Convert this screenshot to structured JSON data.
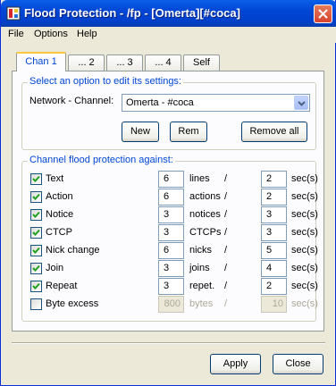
{
  "title": "Flood Protection - /fp - [Omerta][#coca]",
  "menu": [
    "File",
    "Options",
    "Help"
  ],
  "tabs": [
    "Chan 1",
    "... 2",
    "... 3",
    "... 4",
    "Self"
  ],
  "select_group": {
    "label": "Select an option to edit its settings:",
    "network_label": "Network - Channel:",
    "network_value": "Omerta - #coca",
    "new_label": "New",
    "rem_label": "Rem",
    "remove_all_label": "Remove all"
  },
  "flood_group": {
    "label": "Channel flood protection against:",
    "slash": "/",
    "unit": "sec(s)",
    "rows": [
      {
        "name": "Text",
        "checked": true,
        "count": "6",
        "unit": "lines",
        "secs": "2",
        "enabled": true
      },
      {
        "name": "Action",
        "checked": true,
        "count": "6",
        "unit": "actions",
        "secs": "2",
        "enabled": true
      },
      {
        "name": "Notice",
        "checked": true,
        "count": "3",
        "unit": "notices",
        "secs": "3",
        "enabled": true
      },
      {
        "name": "CTCP",
        "checked": true,
        "count": "3",
        "unit": "CTCPs",
        "secs": "3",
        "enabled": true
      },
      {
        "name": "Nick change",
        "checked": true,
        "count": "6",
        "unit": "nicks",
        "secs": "5",
        "enabled": true
      },
      {
        "name": "Join",
        "checked": true,
        "count": "3",
        "unit": "joins",
        "secs": "4",
        "enabled": true
      },
      {
        "name": "Repeat",
        "checked": true,
        "count": "3",
        "unit": "repet.",
        "secs": "2",
        "enabled": true
      },
      {
        "name": "Byte excess",
        "checked": false,
        "count": "800",
        "unit": "bytes",
        "secs": "10",
        "enabled": false
      }
    ]
  },
  "footer": {
    "apply_label": "Apply",
    "close_label": "Close"
  }
}
